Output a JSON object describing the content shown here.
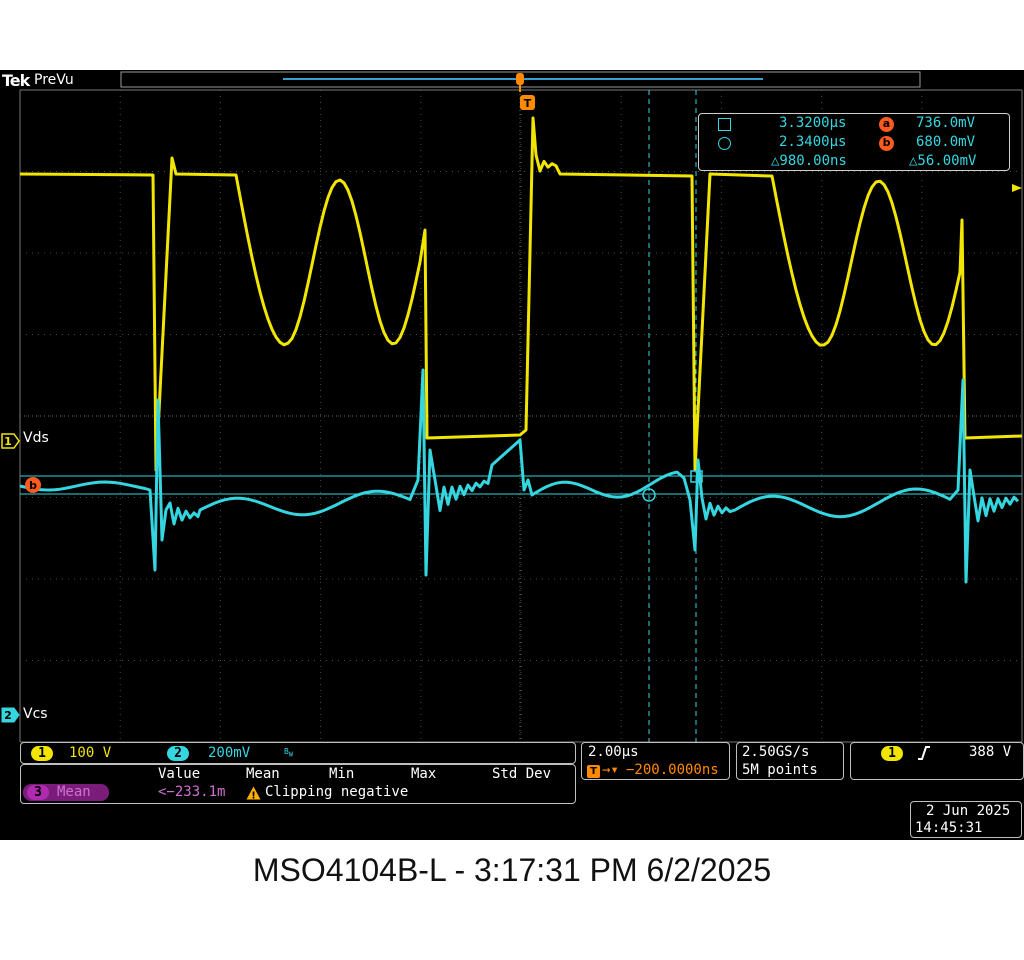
{
  "header": {
    "brand": "Tek",
    "mode": "PreVu"
  },
  "trigger_marker": "T",
  "channels": {
    "ch1": {
      "number": "1",
      "label": "Vds",
      "scale": "100 V",
      "color": "#f2e600"
    },
    "ch2": {
      "number": "2",
      "label": "Vcs",
      "scale": "200mV",
      "bw_icon": "bandwidth-limit-icon",
      "color": "#35d6e0"
    }
  },
  "cursor_readout": {
    "a_time": "3.3200µs",
    "b_time": "2.3400µs",
    "delta_time": "△980.00ns",
    "a_marker": "a",
    "b_marker": "b",
    "a_value": "736.0mV",
    "b_value": "680.0mV",
    "delta_value": "△56.00mV",
    "a_symbol": "square-cursor-icon",
    "b_symbol": "circle-cursor-icon"
  },
  "cursor_marker_b": "b",
  "timebase": {
    "scale": "2.00µs",
    "trigger_icon": "trigger-position-icon",
    "delay": "−200.0000ns"
  },
  "acquisition": {
    "rate": "2.50GS/s",
    "points": "5M points"
  },
  "trigger": {
    "source": "1",
    "slope_icon": "rising-edge-icon",
    "level": "388 V"
  },
  "measurement": {
    "headers": [
      "Value",
      "Mean",
      "Min",
      "Max",
      "Std Dev"
    ],
    "channel": "3",
    "name": "Mean",
    "value": "<−233.1m",
    "warning_icon": "warning-icon",
    "warning": "Clipping negative"
  },
  "clock": {
    "date": "2 Jun 2025",
    "time": "14:45:31"
  },
  "caption": "MSO4104B-L - 3:17:31 PM    6/2/2025",
  "colors": {
    "ch1": "#f2e600",
    "ch2": "#35d6e0",
    "math": "#b02ab0",
    "trigger": "#ff8a00",
    "cursor": "#ff5a1f"
  }
}
